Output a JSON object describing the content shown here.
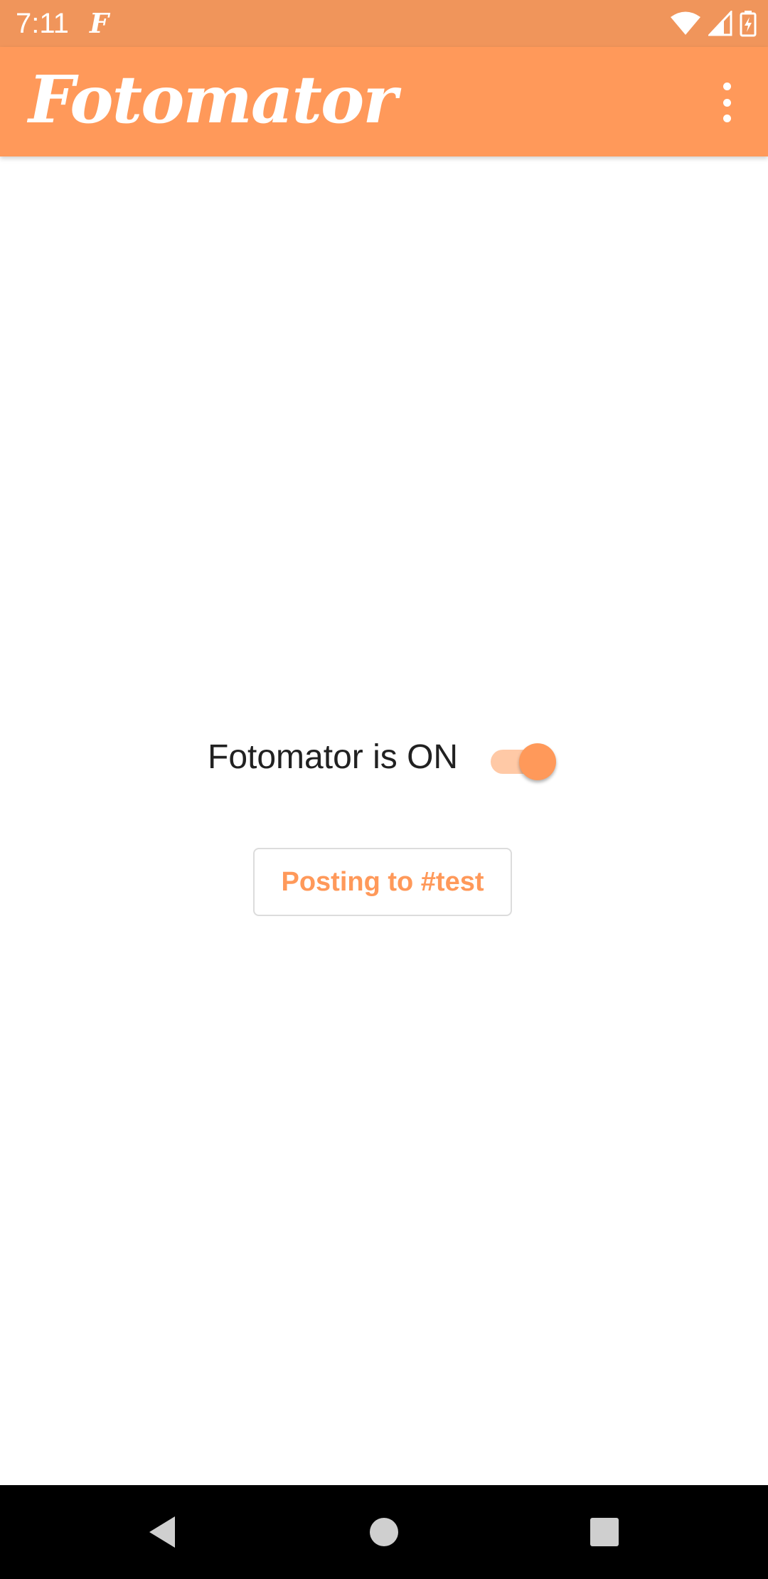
{
  "status_bar": {
    "time": "7:11",
    "app_notification_icon": "fotomator-f-icon",
    "icons": [
      "wifi-icon",
      "cell-signal-icon",
      "battery-charging-icon"
    ],
    "color": "#f0955b"
  },
  "app_bar": {
    "title": "Fotomator",
    "menu_icon": "more-vert-icon",
    "color": "#ff995a"
  },
  "main": {
    "toggle_label": "Fotomator is ON",
    "toggle_state": true,
    "channel_button_label": "Posting to #test",
    "accent_color": "#ff995a"
  },
  "nav_bar": {
    "buttons": [
      "back-icon",
      "home-icon",
      "recents-icon"
    ]
  }
}
